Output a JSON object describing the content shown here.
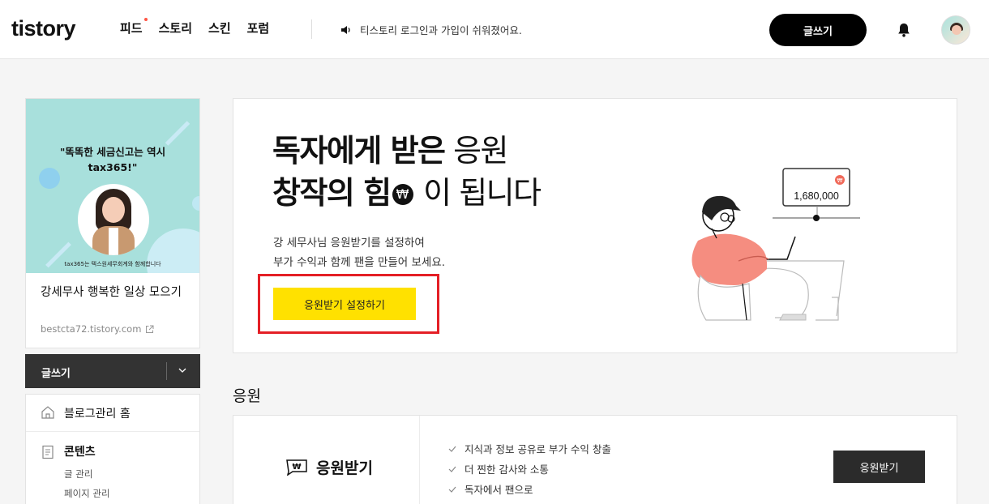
{
  "header": {
    "logo": "tistory",
    "nav": [
      {
        "label": "피드",
        "has_dot": true
      },
      {
        "label": "스토리"
      },
      {
        "label": "스킨"
      },
      {
        "label": "포럼"
      }
    ],
    "notice_text": "티스토리 로그인과 가입이 쉬워졌어요.",
    "write_button": "글쓰기"
  },
  "sidebar": {
    "banner": {
      "title": "\"똑똑한 세금신고는 역시\ntax365!\"",
      "caption": "tax365는 텍스원세무회계와 함께합니다"
    },
    "blog_name": "강세무사 행복한 일상 모으기",
    "blog_url": "bestcta72.tistory.com",
    "write_button": "글쓰기",
    "menu": {
      "home": "블로그관리 홈",
      "content": "콘텐츠",
      "content_items": [
        "글 관리",
        "페이지 관리"
      ]
    }
  },
  "promo": {
    "headline_1_bold": "독자에게 받은",
    "headline_1_light": "응원",
    "headline_2_bold": "창작의 힘",
    "won_symbol": "₩",
    "headline_2_light": "이 됩니다",
    "desc_1": "강 세무사님 응원받기를 설정하여",
    "desc_2": "부가 수익과 함께 팬을 만들어 보세요.",
    "button": "응원받기 설정하기",
    "illustration_amount": "1,680,000"
  },
  "section_title": "응원",
  "support": {
    "name": "응원받기",
    "features": [
      "지식과 정보 공유로 부가 수익 창출",
      "더 찐한 감사와 소통",
      "독자에서 팬으로"
    ],
    "button": "응원받기"
  },
  "colors": {
    "accent_yellow": "#ffe100",
    "highlight_red": "#e41f26",
    "dark": "#2b2b2b"
  }
}
